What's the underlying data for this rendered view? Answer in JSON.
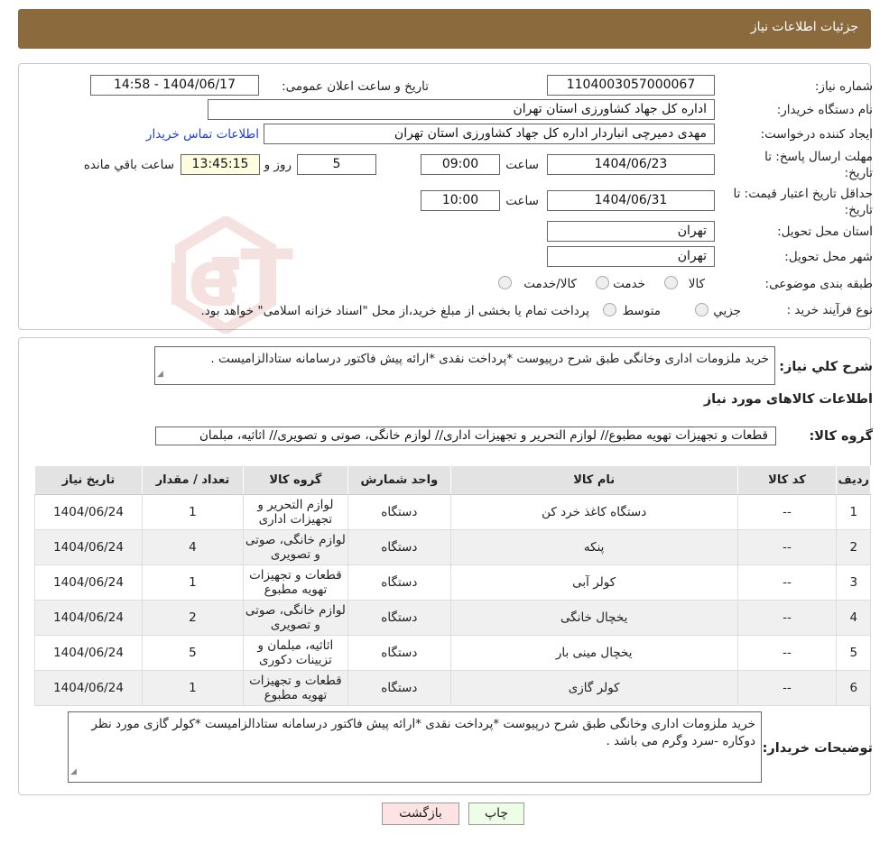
{
  "header": {
    "title": "جزئیات اطلاعات نیاز"
  },
  "fields": {
    "need_number_label": "شماره نیاز:",
    "need_number": "1104003057000067",
    "announce_label": "تاریخ و ساعت اعلان عمومی:",
    "announce_value": "1404/06/17 - 14:58",
    "buyer_org_label": "نام دستگاه خریدار:",
    "buyer_org": "اداره کل جهاد کشاورزی استان تهران",
    "creator_label": "ایجاد کننده درخواست:",
    "creator": "مهدی  دمیرچی انباردار اداره کل جهاد کشاورزی استان تهران",
    "contact_link": "اطلاعات تماس خریدار",
    "deadline_label_1": "مهلت ارسال پاسخ: تا",
    "deadline_label_2": "تاریخ:",
    "deadline_date": "1404/06/23",
    "time_label": "ساعت",
    "deadline_time": "09:00",
    "days_value": "5",
    "days_label": "روز و",
    "remaining_time": "13:45:15",
    "remaining_label": "ساعت باقي مانده",
    "validity_label_1": "حداقل تاریخ اعتبار قیمت: تا",
    "validity_label_2": "تاریخ:",
    "validity_date": "1404/06/31",
    "validity_time": "10:00",
    "province_label": "استان محل تحویل:",
    "province": "تهران",
    "city_label": "شهر محل تحویل:",
    "city": "تهران",
    "category_label": "طبقه بندی موضوعی:",
    "category_options": [
      "کالا",
      "خدمت",
      "کالا/خدمت"
    ],
    "process_label": "نوع فرآیند خرید :",
    "process_options": [
      "جزیي",
      "متوسط"
    ],
    "process_note": "پرداخت تمام یا بخشی از مبلغ خرید،از محل \"اسناد خزانه اسلامی\" خواهد بود."
  },
  "summary": {
    "label": "شرح کلي نیاز:",
    "text": "خرید ملزومات اداری وخانگی طبق شرح درپیوست *پرداخت نقدی *ارائه پیش فاکتور درسامانه ستادالزامیست ."
  },
  "goods": {
    "section_title": "اطلاعات کالاهای مورد نیاز",
    "group_label": "گروه کالا:",
    "group_value": "قطعات و تجهیزات تهویه مطبوع// لوازم التحریر و تجهیزات اداری// لوازم خانگی، صوتی و تصویری// اثاثیه، مبلمان"
  },
  "table": {
    "headers": [
      "ردیف",
      "کد کالا",
      "نام کالا",
      "واحد شمارش",
      "گروه کالا",
      "تعداد / مقدار",
      "تاریخ نیاز"
    ],
    "rows": [
      [
        "1",
        "--",
        "دستگاه کاغذ خرد کن",
        "دستگاه",
        "لوازم التحریر و تجهیزات اداری",
        "1",
        "1404/06/24"
      ],
      [
        "2",
        "--",
        "پنکه",
        "دستگاه",
        "لوازم خانگی، صوتی و تصویری",
        "4",
        "1404/06/24"
      ],
      [
        "3",
        "--",
        "کولر آبی",
        "دستگاه",
        "قطعات و تجهیزات تهویه مطبوع",
        "1",
        "1404/06/24"
      ],
      [
        "4",
        "--",
        "یخچال خانگی",
        "دستگاه",
        "لوازم خانگی، صوتی و تصویری",
        "2",
        "1404/06/24"
      ],
      [
        "5",
        "--",
        "یخچال مینی بار",
        "دستگاه",
        "اثاثیه، مبلمان و تزیینات دکوری",
        "5",
        "1404/06/24"
      ],
      [
        "6",
        "--",
        "کولر گازی",
        "دستگاه",
        "قطعات و تجهیزات تهویه مطبوع",
        "1",
        "1404/06/24"
      ]
    ]
  },
  "buyer_notes": {
    "label": "توضیحات خریدار:",
    "text": "خرید ملزومات اداری وخانگی طبق شرح درپیوست *پرداخت نقدی *ارائه پیش فاکتور درسامانه ستادالزامیست *کولر گازی مورد نظر دوکاره -سرد وگرم می باشد ."
  },
  "buttons": {
    "print": "چاپ",
    "back": "بازگشت"
  },
  "watermark": {
    "text": "AriaTender.neT"
  },
  "colors": {
    "header_bg": "#8b6a3e",
    "link": "#1f3fd6",
    "back_btn_bg": "#fde3e3",
    "print_btn_bg": "#eefde6",
    "remaining_bg": "#fffde0"
  }
}
